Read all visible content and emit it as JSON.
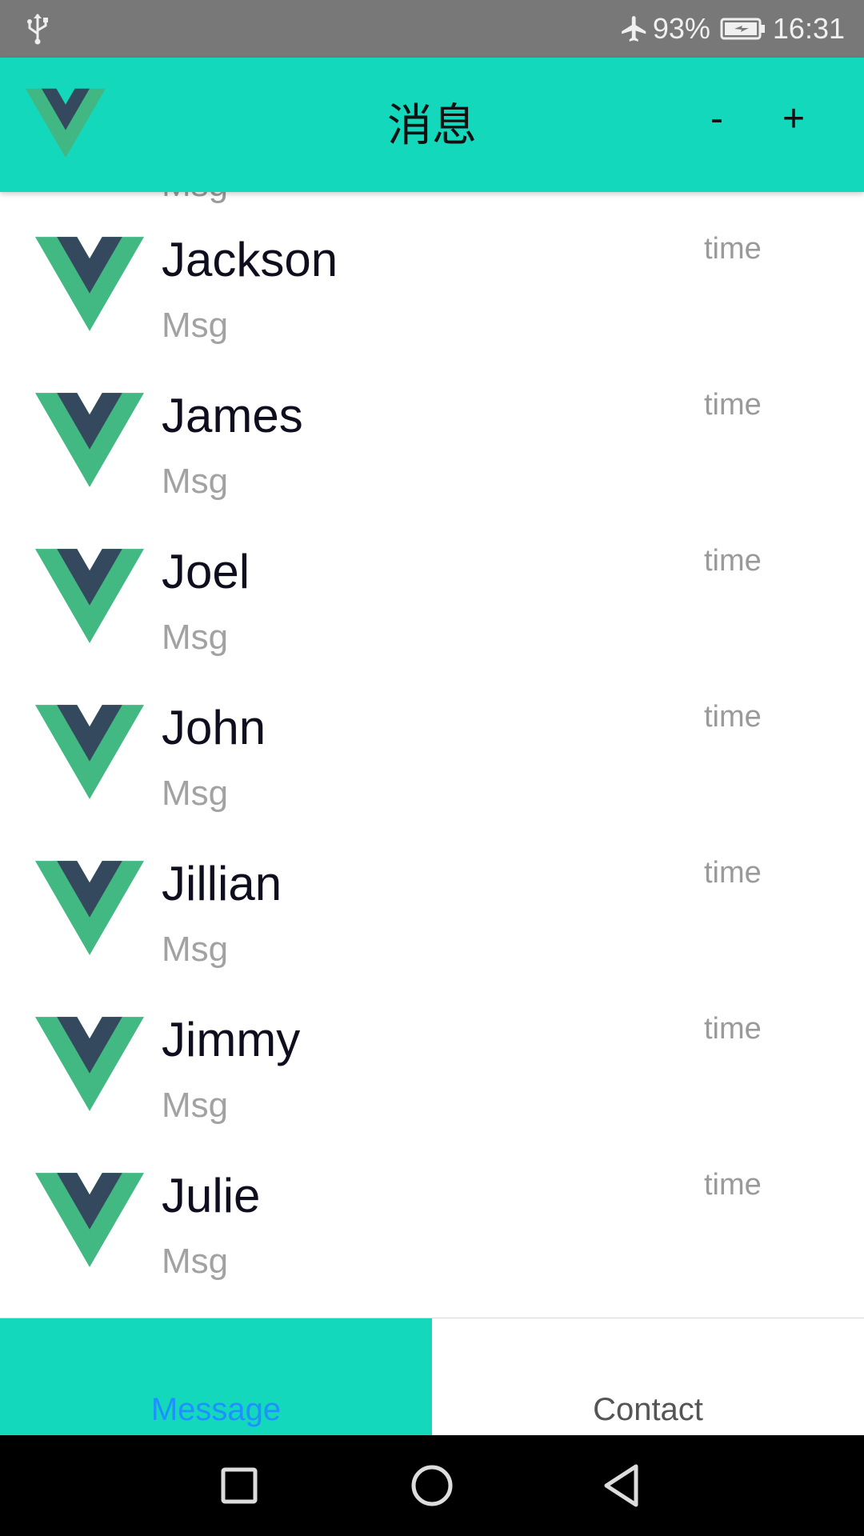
{
  "status_bar": {
    "battery": "93%",
    "time": "16:31",
    "icons": [
      "usb-icon",
      "airplane-mode-icon",
      "battery-charging-icon"
    ]
  },
  "header": {
    "title": "消息",
    "minus_label": "-",
    "plus_label": "+",
    "logo_icon": "vue-logo-icon"
  },
  "messages": {
    "partial_above": "Msg",
    "items": [
      {
        "name": "Jackson",
        "msg": "Msg",
        "time": "time"
      },
      {
        "name": "James",
        "msg": "Msg",
        "time": "time"
      },
      {
        "name": "Joel",
        "msg": "Msg",
        "time": "time"
      },
      {
        "name": "John",
        "msg": "Msg",
        "time": "time"
      },
      {
        "name": "Jillian",
        "msg": "Msg",
        "time": "time"
      },
      {
        "name": "Jimmy",
        "msg": "Msg",
        "time": "time"
      },
      {
        "name": "Julie",
        "msg": "Msg",
        "time": "time"
      }
    ]
  },
  "tabs": [
    {
      "label": "Message",
      "active": true
    },
    {
      "label": "Contact",
      "active": false
    }
  ],
  "nav_bar": {
    "icons": [
      "recent-apps-icon",
      "home-icon",
      "back-icon"
    ]
  },
  "colors": {
    "accent": "#13d8bc",
    "vue_green": "#42b883",
    "vue_dark": "#35495e",
    "active_tab_text": "#1e90ff"
  }
}
